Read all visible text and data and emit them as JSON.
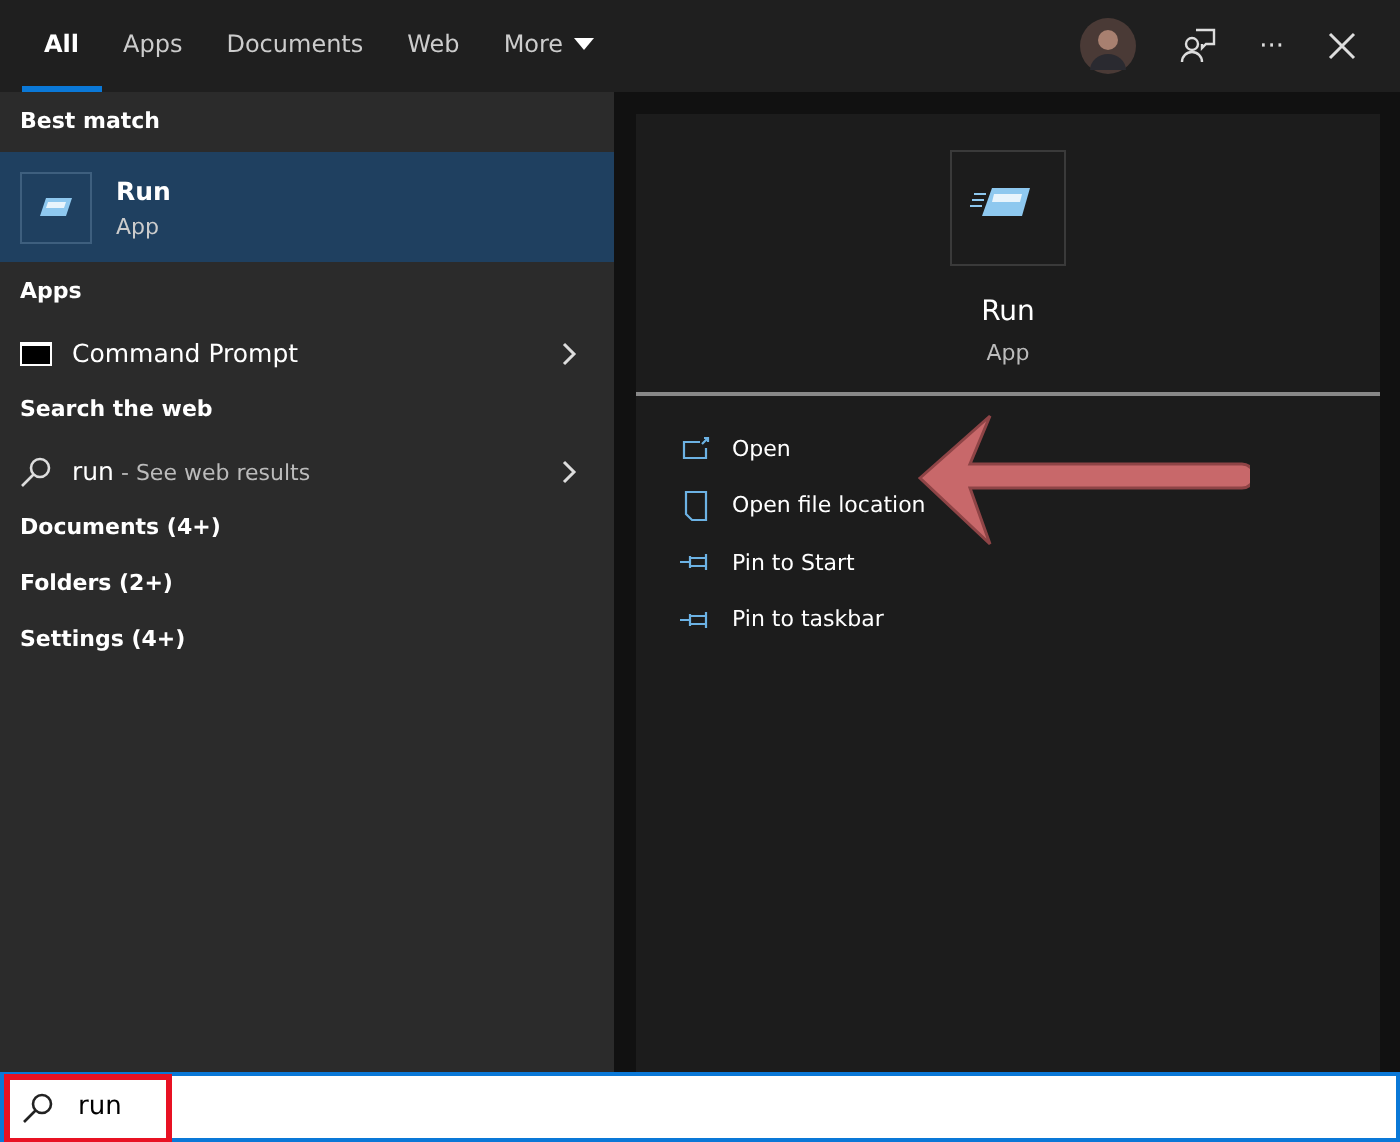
{
  "tabs": [
    {
      "label": "All",
      "selected": true,
      "kind": "plain"
    },
    {
      "label": "Apps",
      "selected": false,
      "kind": "plain"
    },
    {
      "label": "Documents",
      "selected": false,
      "kind": "plain"
    },
    {
      "label": "Web",
      "selected": false,
      "kind": "plain"
    },
    {
      "label": "More",
      "selected": false,
      "kind": "dropdown"
    }
  ],
  "more_icon": "···",
  "results": [
    {
      "kind": "heading",
      "label": "Best match"
    },
    {
      "kind": "best",
      "title": "Run",
      "subtitle": "App",
      "selected": true
    },
    {
      "kind": "heading",
      "label": "Apps"
    },
    {
      "kind": "app",
      "title": "Command Prompt"
    },
    {
      "kind": "heading",
      "label": "Search the web"
    },
    {
      "kind": "web",
      "query": "run",
      "suffix": " - See web results"
    },
    {
      "kind": "heading",
      "label": "Documents (4+)"
    },
    {
      "kind": "heading",
      "label": "Folders (2+)"
    },
    {
      "kind": "heading",
      "label": "Settings (4+)"
    }
  ],
  "preview": {
    "title": "Run",
    "subtitle": "App",
    "actions": [
      {
        "kind": "open",
        "label": "Open"
      },
      {
        "kind": "folder",
        "label": "Open file location"
      },
      {
        "kind": "pin",
        "label": "Pin to Start"
      },
      {
        "kind": "pin",
        "label": "Pin to taskbar"
      }
    ]
  },
  "search": {
    "value": "run"
  }
}
